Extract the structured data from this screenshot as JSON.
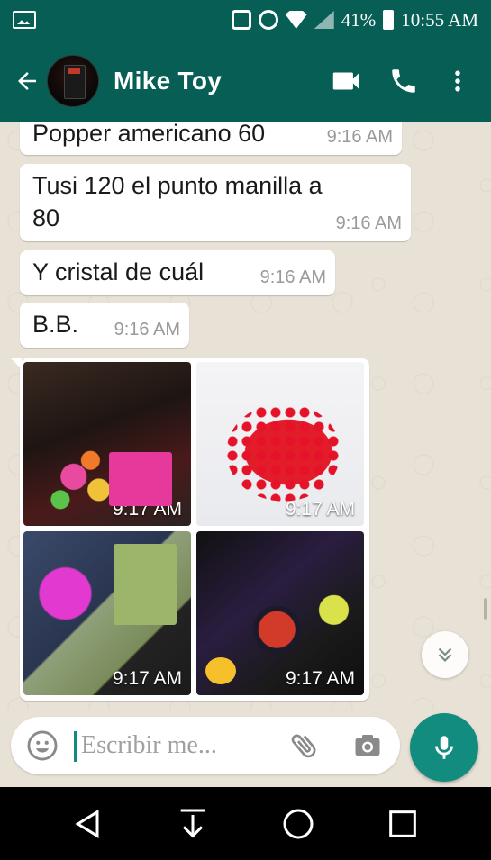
{
  "status_bar": {
    "battery": "41%",
    "time": "10:55 AM"
  },
  "header": {
    "contact_name": "Mike Toy",
    "icons": [
      "back-arrow-icon",
      "video-call-icon",
      "phone-icon",
      "more-vert-icon"
    ]
  },
  "messages": [
    {
      "text": "Popper americano 60",
      "time": "9:16 AM"
    },
    {
      "text": "Tusi 120 el punto manilla a 80",
      "time": "9:16 AM"
    },
    {
      "text": "Y cristal de cuál",
      "time": "9:16 AM"
    },
    {
      "text": "B.B.",
      "time": "9:16 AM"
    }
  ],
  "media_message": {
    "photos": [
      {
        "time": "9:17 AM"
      },
      {
        "time": "9:17 AM"
      },
      {
        "time": "9:17 AM"
      },
      {
        "time": "9:17 AM"
      }
    ]
  },
  "composer": {
    "placeholder": "Escribir me...",
    "icons": [
      "emoji-icon",
      "attach-clip-icon",
      "camera-icon",
      "mic-icon"
    ]
  },
  "nav": {
    "icons": [
      "back-triangle-icon",
      "download-icon",
      "home-circle-icon",
      "recents-square-icon"
    ]
  },
  "colors": {
    "header": "#075e54",
    "accent": "#128c7e",
    "chat_bg": "#e8e1d6",
    "bubble": "#ffffff"
  }
}
